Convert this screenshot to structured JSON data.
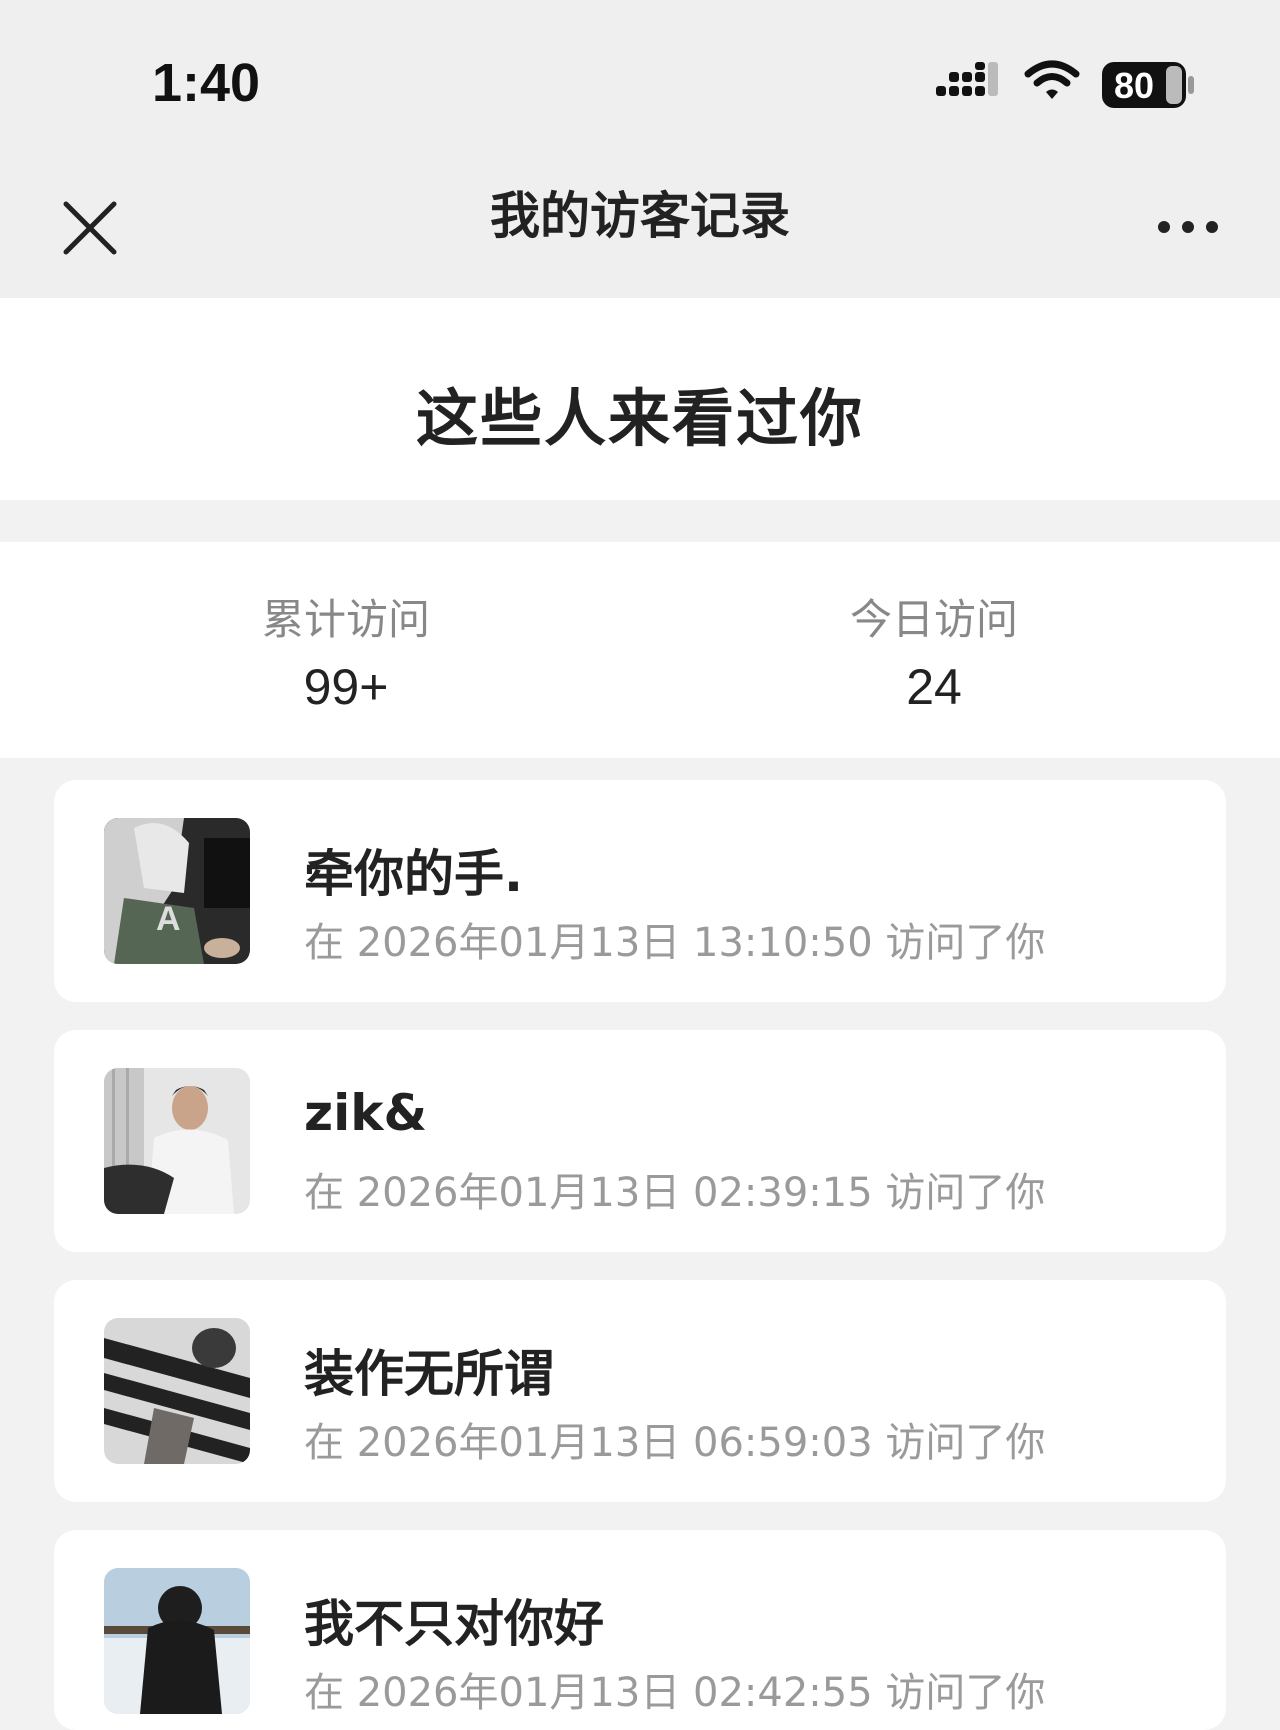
{
  "status_bar": {
    "time": "1:40",
    "battery": "80",
    "icons": [
      "cellular-signal-icon",
      "wifi-icon",
      "battery-icon"
    ]
  },
  "nav": {
    "title": "我的访客记录",
    "close_icon": "close-icon",
    "more_icon": "more-dots-icon"
  },
  "hero": {
    "title": "这些人来看过你"
  },
  "stats": {
    "total_label": "累计访问",
    "total_value": "99+",
    "today_label": "今日访问",
    "today_value": "24"
  },
  "visitors": [
    {
      "name": "牵你的手.",
      "visit_text": "在 2026年01月13日 13:10:50 访问了你"
    },
    {
      "name": "zik&",
      "visit_text": "在 2026年01月13日 02:39:15 访问了你"
    },
    {
      "name": "装作无所谓",
      "visit_text": "在 2026年01月13日 06:59:03 访问了你"
    },
    {
      "name": "我不只对你好",
      "visit_text": "在 2026年01月13日 02:42:55 访问了你"
    }
  ]
}
